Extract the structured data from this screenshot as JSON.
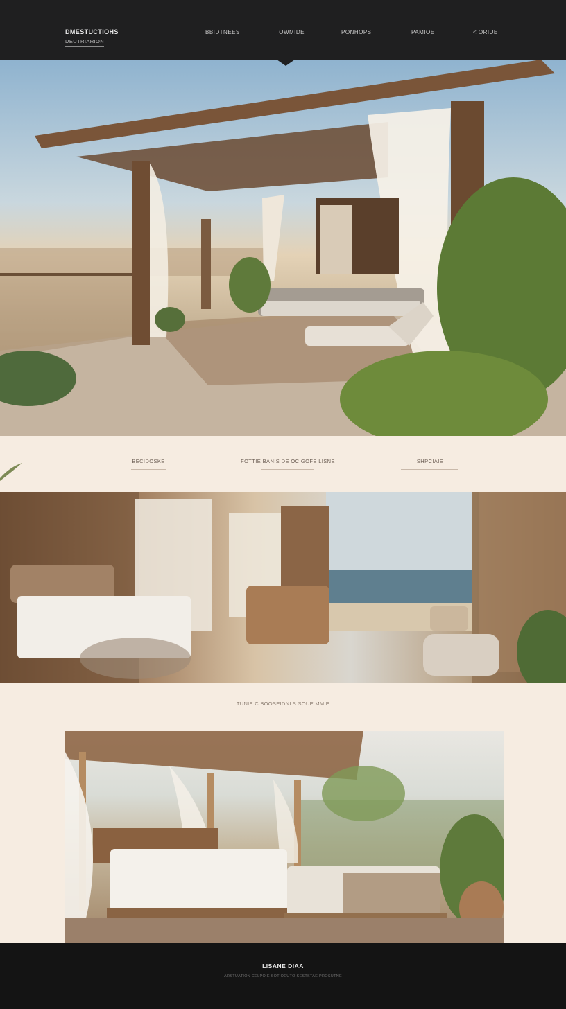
{
  "header": {
    "brand": "DMESTUCTIOHS",
    "brand_sub": "DEUTRIARION",
    "nav": [
      "BBIDTNEES",
      "TOWMIDE",
      "PONHOPS",
      "PAMIOE",
      "< ORIUE"
    ]
  },
  "band": {
    "col1": "BECIDOSKE",
    "col2": "FOTTIE BANIS DE OCIGOFE LISNE",
    "col3": "SHPCIAIE"
  },
  "caption": "TUNIE C BOOSEIDNLS SOUE MMIE",
  "footer": {
    "title": "LISANE DIAA",
    "subtitle": "ARSTUATION CELPOIE SOTIOEUTO SESTSTAE PROSUTNE"
  },
  "colors": {
    "header_bg": "#1f1f20",
    "page_bg": "#f6ece1",
    "footer_bg": "#141414"
  }
}
